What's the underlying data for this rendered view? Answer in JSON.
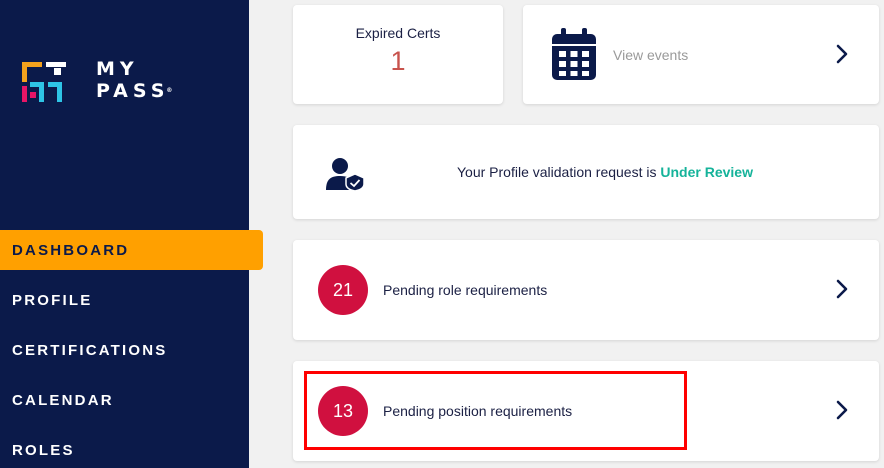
{
  "brand": {
    "line1": "MY",
    "line2": "PASS",
    "reg": "®"
  },
  "nav": [
    {
      "label": "DASHBOARD",
      "active": true
    },
    {
      "label": "PROFILE"
    },
    {
      "label": "CERTIFICATIONS"
    },
    {
      "label": "CALENDAR"
    },
    {
      "label": "ROLES"
    }
  ],
  "expired_certs": {
    "label": "Expired Certs",
    "value": "1"
  },
  "events": {
    "label": "View events"
  },
  "profile_validation": {
    "text": "Your Profile validation request is ",
    "status": "Under Review"
  },
  "role_requirements": {
    "count": "21",
    "label": "Pending role requirements"
  },
  "position_requirements": {
    "count": "13",
    "label": "Pending position requirements"
  },
  "colors": {
    "sidebar": "#0b1a4a",
    "accent": "#ffa000",
    "badge": "#d0103f",
    "status": "#15b39a",
    "highlight": "#ff0000"
  }
}
